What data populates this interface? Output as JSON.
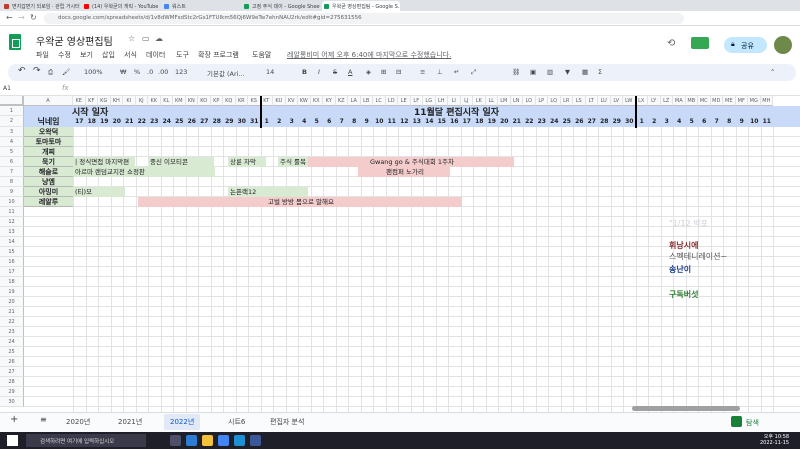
{
  "browser": {
    "tabs": [
      {
        "label": "면지갑면기 되로임 · 관립 거시터",
        "color": "#c53929"
      },
      {
        "label": "(14) 우왁굳의 게릭 - YouTube",
        "color": "#ff0000"
      },
      {
        "label": "워스트",
        "color": "#4285f4"
      },
      {
        "label": "고정 주식 데이 - Google Sheets",
        "color": "#0f9d58"
      },
      {
        "label": "우왁굳 영상편집팀 - Google S...",
        "color": "#0f9d58"
      }
    ],
    "url": "docs.google.com/spreadsheets/d/1v8dWMFsdStc2rGs1FTUIkm56Qj6W9eTw7ehnNAU2rk/edit#gid=275631556"
  },
  "doc": {
    "title": "우왁굳 영상편집팀",
    "menus": [
      "파일",
      "수정",
      "보기",
      "삽입",
      "서식",
      "데이터",
      "도구",
      "확장 프로그램",
      "도움말"
    ],
    "last_edit": "레알롱비미 어제 오후 6:40에 마지막으로 수정했습니다.",
    "share_label": "공유"
  },
  "toolbar": {
    "zoom": "100%",
    "currency": "₩",
    "percent": "%",
    "decimal1": ".0",
    "decimal2": ".00",
    "format": "123",
    "font": "기본값 (Ari...",
    "font_size": "14",
    "bold": "B",
    "italic": "I",
    "strike": "S",
    "textcolor": "A"
  },
  "formula_bar": {
    "name_box": "A1",
    "fx": "fx"
  },
  "columns": [
    "A",
    "KE",
    "KF",
    "KG",
    "KH",
    "KI",
    "KJ",
    "KK",
    "KL",
    "KM",
    "KN",
    "KO",
    "KP",
    "KQ",
    "KR",
    "KS",
    "KT",
    "KU",
    "KV",
    "KW",
    "KX",
    "KY",
    "KZ",
    "LA",
    "LB",
    "LC",
    "LD",
    "LE",
    "LF",
    "LG",
    "LH",
    "LI",
    "LJ",
    "LK",
    "LL",
    "LM",
    "LN",
    "LO",
    "LP",
    "LQ",
    "LR",
    "LS",
    "LT",
    "LU",
    "LV",
    "LW",
    "LX",
    "LY",
    "LZ",
    "MA",
    "MB",
    "MC",
    "MD",
    "ME",
    "MF",
    "MG",
    "MH"
  ],
  "rows": [
    "1",
    "2",
    "3",
    "4",
    "5",
    "6",
    "7",
    "8",
    "9",
    "10",
    "11",
    "12",
    "13",
    "14",
    "15",
    "16",
    "17",
    "18",
    "19",
    "20",
    "21",
    "22",
    "23",
    "24",
    "25",
    "26",
    "27",
    "28",
    "29",
    "30"
  ],
  "sheet": {
    "header_left": "시작 일자",
    "header_mid": "11월달 편집시작 일자",
    "name_header": "닉네임",
    "days_oct": [
      "17",
      "18",
      "19",
      "20",
      "21",
      "22",
      "23",
      "24",
      "25",
      "26",
      "27",
      "28",
      "29",
      "30",
      "31"
    ],
    "days_nov": [
      "1",
      "2",
      "3",
      "4",
      "5",
      "6",
      "7",
      "8",
      "9",
      "10",
      "11",
      "12",
      "13",
      "14",
      "15",
      "16",
      "17",
      "18",
      "19",
      "20",
      "21",
      "22",
      "23",
      "24",
      "25",
      "26",
      "27",
      "28",
      "29",
      "30"
    ],
    "days_dec": [
      "1",
      "2",
      "3",
      "4",
      "5",
      "6",
      "7",
      "8",
      "9",
      "10",
      "11"
    ],
    "names": [
      "오왁덕",
      "토마토마",
      "개찌",
      "묵기",
      "해슬로",
      "냥엠",
      "아밍미",
      "레알루"
    ],
    "bars": [
      {
        "row": 3,
        "text": "| 정식면접 마지막편",
        "color": "green"
      },
      {
        "row": 3,
        "text": "중신 이모티콘",
        "color": "green"
      },
      {
        "row": 3,
        "text": "상륜 자막",
        "color": "green"
      },
      {
        "row": 3,
        "text": "주식 룰복",
        "color": "green"
      },
      {
        "row": 3,
        "text": "Gwang go & 주식대회 1주차",
        "color": "pink"
      },
      {
        "row": 4,
        "text": "아르마 랜덤교지전 쇼정판",
        "color": "green"
      },
      {
        "row": 4,
        "text": "팬컴퍼 노가리",
        "color": "pink"
      },
      {
        "row": 6,
        "text": "(티)모",
        "color": "green"
      },
      {
        "row": 6,
        "text": "논픈랙12",
        "color": "green"
      },
      {
        "row": 7,
        "text": "고벌 방방 몸으로 말해요",
        "color": "pink"
      }
    ]
  },
  "overlay": {
    "line1": "\"1/12 박포",
    "line2": "휘낭시에",
    "line3": "스펙테니레이션~",
    "line4": "송난이",
    "line5": "구독버섯",
    "c1": "#d2ccd8",
    "c2": "#8b2f2f",
    "c3": "#555555",
    "c4": "#1a3c8b",
    "c5": "#2e7d32"
  },
  "sheet_tabs": [
    "2020년",
    "2021년",
    "2022년",
    "시트6",
    "편집자 분석"
  ],
  "explore_label": "탐색",
  "taskbar": {
    "search": "검색하려면 여기에 입력하십시오",
    "time": "오후 10:58",
    "date": "2022-11-15"
  }
}
